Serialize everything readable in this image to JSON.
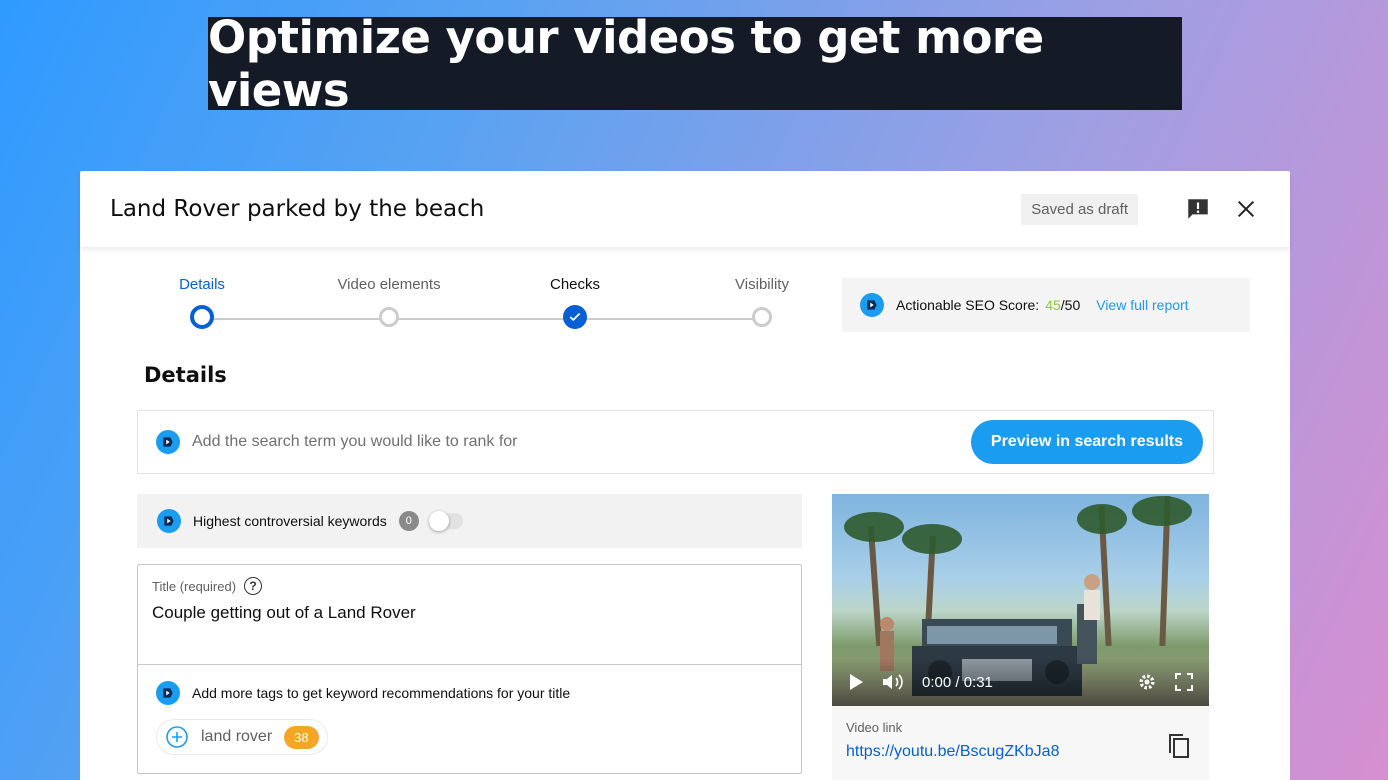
{
  "banner": {
    "text": "Optimize your videos to get more views"
  },
  "dialog": {
    "title": "Land Rover parked by the beach",
    "status_badge": "Saved as draft"
  },
  "stepper": {
    "steps": [
      {
        "label": "Details",
        "state": "active"
      },
      {
        "label": "Video elements",
        "state": "pending"
      },
      {
        "label": "Checks",
        "state": "done"
      },
      {
        "label": "Visibility",
        "state": "pending"
      }
    ]
  },
  "seo": {
    "label": "Actionable SEO Score:",
    "score": "45",
    "total": "/50",
    "link": "View full report",
    "score_color": "#8dc63f"
  },
  "details": {
    "heading": "Details",
    "search_placeholder": "Add the search term you would like to rank for",
    "preview_button": "Preview in search results",
    "controversial_label": "Highest controversial keywords",
    "controversial_count": "0",
    "controversial_toggle_on": false,
    "title_label": "Title (required)",
    "help_glyph": "?",
    "title_value": "Couple getting out of a Land Rover",
    "tags_hint": "Add more tags to get keyword recommendations for your title",
    "tag": {
      "text": "land rover",
      "score": "38"
    }
  },
  "video": {
    "time": "0:00 / 0:31",
    "link_label": "Video link",
    "link_url": "https://youtu.be/BscugZKbJa8"
  },
  "colors": {
    "accent": "#065fd4",
    "vidiq_blue": "#1a9cf0",
    "banner_bg": "#141a26",
    "tag_score": "#f5a623"
  },
  "icons": [
    "vidiq-logo-icon",
    "feedback-icon",
    "close-icon",
    "check-icon",
    "plus-circle-icon",
    "play-icon",
    "volume-icon",
    "settings-icon",
    "fullscreen-icon",
    "copy-icon"
  ]
}
